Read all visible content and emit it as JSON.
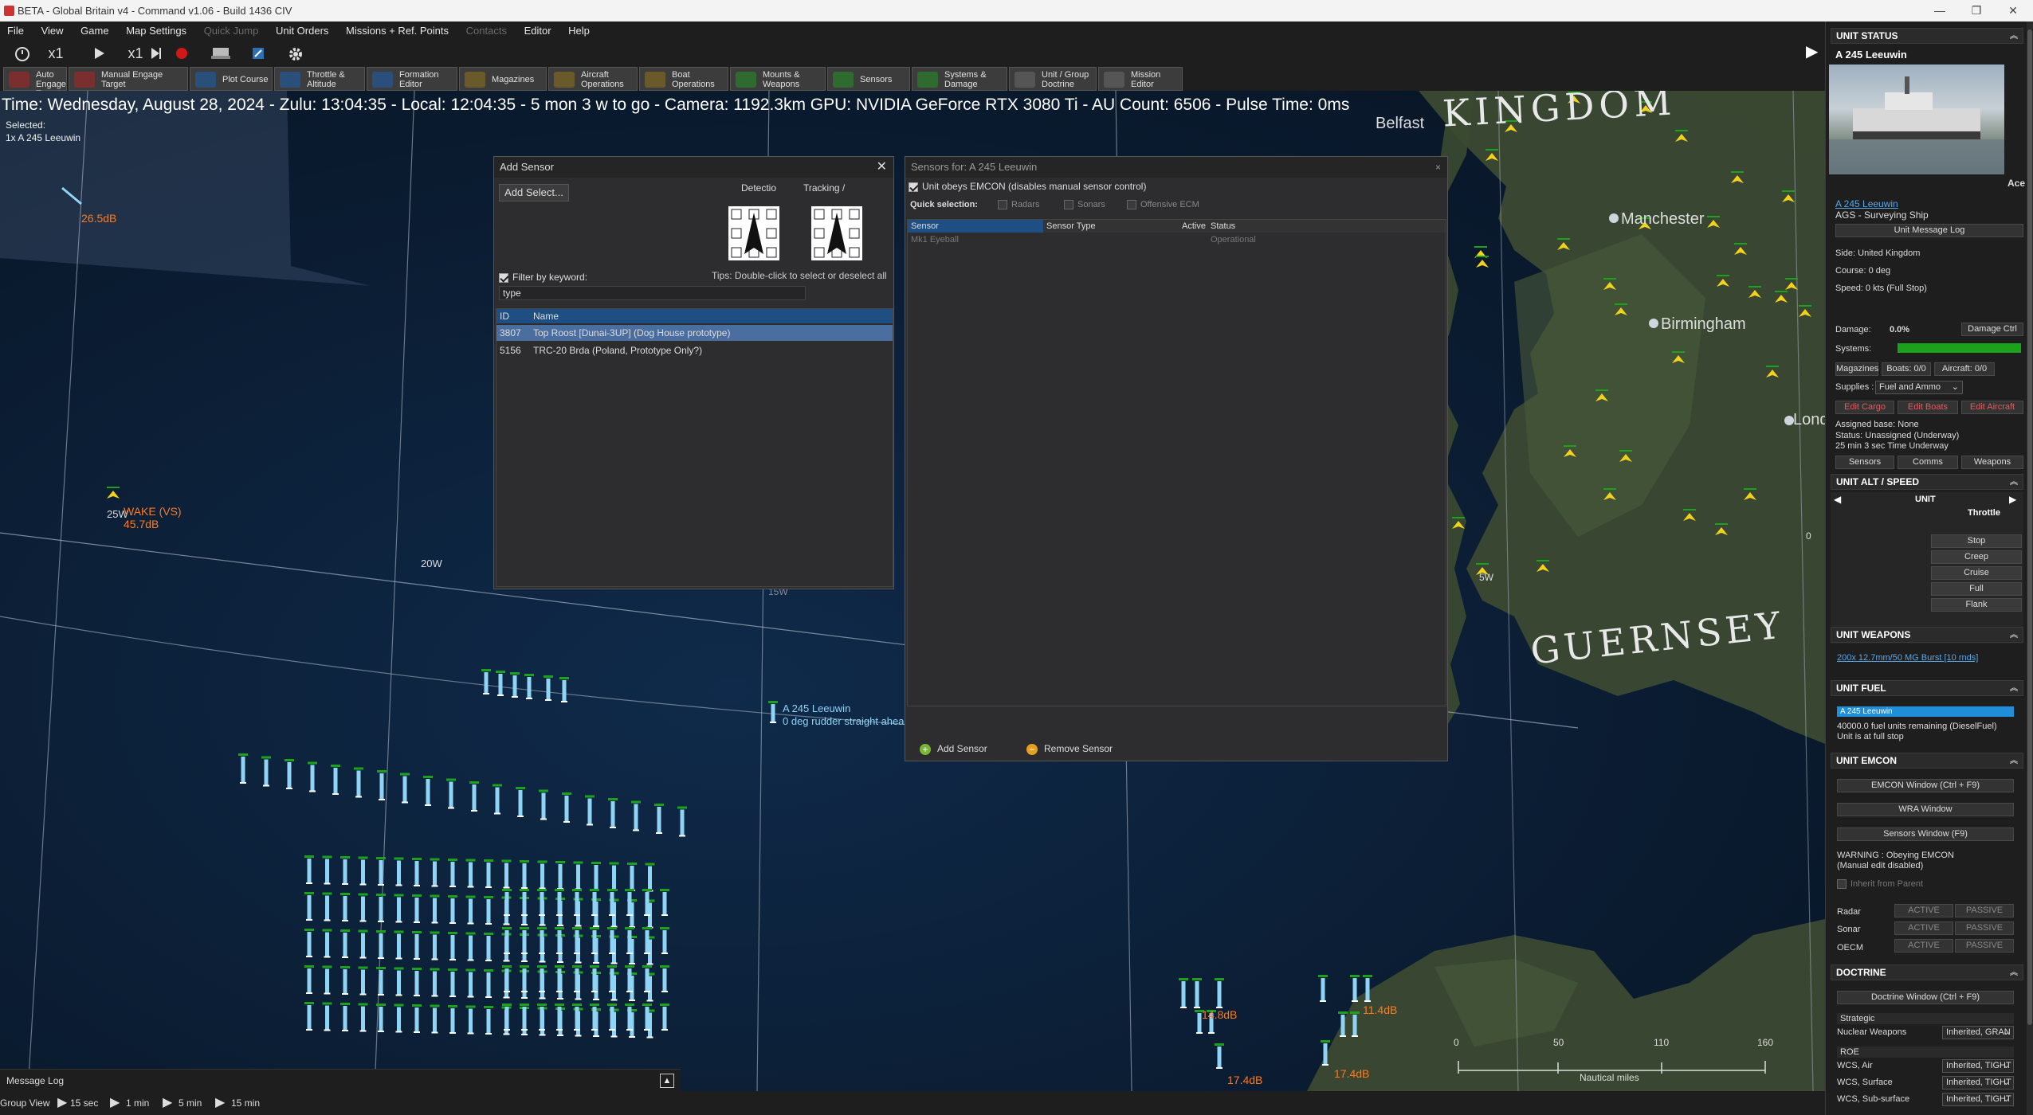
{
  "window": {
    "title": "BETA - Global Britain v4 - Command v1.06 - Build 1436 CIV",
    "minimize": "—",
    "maximize": "❐",
    "close": "✕"
  },
  "menu": [
    "File",
    "View",
    "Game",
    "Map Settings",
    "Quick Jump",
    "Unit Orders",
    "Missions + Ref. Points",
    "Contacts",
    "Editor",
    "Help"
  ],
  "toolbar1": {
    "speed1": "x1",
    "speed2": "x1"
  },
  "toolbar2": [
    {
      "label": "Auto Engage Target"
    },
    {
      "label": "Manual Engage Target"
    },
    {
      "label": "Plot Course"
    },
    {
      "label": "Throttle & Altitude"
    },
    {
      "label": "Formation Editor"
    },
    {
      "label": "Magazines"
    },
    {
      "label": "Aircraft Operations"
    },
    {
      "label": "Boat Operations"
    },
    {
      "label": "Mounts & Weapons"
    },
    {
      "label": "Sensors"
    },
    {
      "label": "Systems & Damage"
    },
    {
      "label": "Unit / Group Doctrine"
    },
    {
      "label": "Mission Editor"
    }
  ],
  "map": {
    "status_line": "Time: Wednesday, August 28, 2024 - Zulu: 13:04:35 - Local: 12:04:35 - 5 mon 3 w to go - Camera: 1192.3km GPU: NVIDIA GeForce RTX 3080 Ti - AU Count: 6506 - Pulse Time: 0ms",
    "selected_label": "Selected:",
    "selected_value": "1x A 245 Leeuwin",
    "labels": {
      "kingdom": "KINGDOM",
      "guernsey": "GUERNSEY",
      "belfast": "Belfast",
      "manchester": "Manchester",
      "birmingham": "Birmingham",
      "london": "Lond",
      "lon_20w": "20W",
      "lon_25w": "25W",
      "lon_15w": "15W",
      "lon_5w": "5W",
      "lon_0": "0",
      "wake": "WAKE (VS)",
      "wake_db": "45.7dB",
      "db_top": "26.5dB",
      "unit_name": "A 245 Leeuwin",
      "unit_course": "0 deg  rudder straight ahead",
      "db_a": "14.8dB",
      "db_b": "11.4dB",
      "db_c": "17.4dB",
      "db_d": "17.4dB"
    },
    "scale": {
      "ticks": [
        "0",
        "50",
        "110",
        "160"
      ],
      "unit": "Nautical miles"
    }
  },
  "add_sensor": {
    "title": "Add Sensor",
    "close": "✕",
    "add_select": "Add Select...",
    "detection": "Detectio",
    "tracking": "Tracking /",
    "tips": "Tips: Double-click to select or deselect all",
    "filter_label": "Filter by keyword:",
    "filter_value": "type",
    "columns": [
      "ID",
      "Name"
    ],
    "rows": [
      {
        "id": "3807",
        "name": "Top Roost [Dunai-3UP] (Dog House prototype)"
      },
      {
        "id": "5156",
        "name": "TRC-20 Brda (Poland, Prototype Only?)"
      }
    ]
  },
  "sensors_for": {
    "title": "Sensors for: A 245 Leeuwin",
    "close": "×",
    "emcon_label": "Unit obeys EMCON (disables manual sensor control)",
    "quick_label": "Quick selection:",
    "quick": [
      "Radars",
      "Sonars",
      "Offensive ECM"
    ],
    "columns": [
      "Sensor",
      "Sensor Type",
      "Active",
      "Status"
    ],
    "rows": [
      {
        "sensor": "Mk1 Eyeball",
        "type": "",
        "active": "",
        "status": "Operational"
      }
    ],
    "add_btn": "Add Sensor",
    "remove_btn": "Remove Sensor"
  },
  "unit_status": {
    "header": "UNIT STATUS",
    "name": "A 245 Leeuwin",
    "ace": "Ace",
    "link": "A 245 Leeuwin",
    "type": "AGS - Surveying Ship",
    "msg_log": "Unit Message Log",
    "side": "Side: United Kingdom",
    "course": "Course: 0 deg",
    "speed": "Speed: 0 kts (Full Stop)",
    "damage_label": "Damage:",
    "damage_value": "0.0%",
    "damage_btn": "Damage Ctrl",
    "systems_label": "Systems:",
    "systems_level": 1.0,
    "magazines": "Magazines",
    "boats": "Boats: 0/0",
    "aircraft": "Aircraft: 0/0",
    "supplies_label": "Supplies :",
    "supplies_value": "Fuel and Ammo",
    "edit_cargo": "Edit Cargo",
    "edit_boats": "Edit Boats",
    "edit_aircraft": "Edit Aircraft",
    "assigned": "Assigned base: None",
    "status": "Status: Unassigned (Underway)",
    "underway": "25 min 3 sec Time Underway",
    "btn_sensors": "Sensors",
    "btn_comms": "Comms",
    "btn_weapons": "Weapons"
  },
  "alt_speed": {
    "header": "UNIT ALT / SPEED",
    "unit": "UNIT",
    "throttle": "Throttle",
    "buttons": [
      "Stop",
      "Creep",
      "Cruise",
      "Full",
      "Flank"
    ]
  },
  "weapons": {
    "header": "UNIT WEAPONS",
    "item": "200x 12.7mm/50 MG Burst [10 rnds]"
  },
  "fuel": {
    "header": "UNIT FUEL",
    "bar_label": "A 245 Leeuwin",
    "level": 1.0,
    "remaining": "40000.0 fuel units remaining (DieselFuel)",
    "state": "Unit is at full stop"
  },
  "emcon": {
    "header": "UNIT EMCON",
    "emcon_window": "EMCON Window (Ctrl + F9)",
    "wra_window": "WRA Window",
    "sensors_window": "Sensors Window (F9)",
    "warning": "WARNING : Obeying EMCON",
    "warning2": "(Manual edit disabled)",
    "inherit": "Inherit from Parent",
    "rows": [
      "Radar",
      "Sonar",
      "OECM"
    ],
    "active": "ACTIVE",
    "passive": "PASSIVE"
  },
  "doctrine": {
    "header": "DOCTRINE",
    "window": "Doctrine Window (Ctrl + F9)",
    "strategic": "Strategic",
    "nuclear_label": "Nuclear Weapons",
    "nuclear_value": "Inherited, GRAN",
    "roe": "ROE",
    "wcs": [
      {
        "label": "WCS, Air",
        "value": "Inherited, TIGHT"
      },
      {
        "label": "WCS, Surface",
        "value": "Inherited, TIGHT"
      },
      {
        "label": "WCS, Sub-surface",
        "value": "Inherited, TIGHT"
      }
    ]
  },
  "message_log": "Message Log",
  "bottom": {
    "group_view": "Group View",
    "steps": [
      "15 sec",
      "1 min",
      "5 min",
      "15 min"
    ]
  },
  "colors": {
    "accent": "#1e6fb5",
    "green": "#1aa31a",
    "orange": "#ff7a1a",
    "cyan": "#8fd3f5"
  }
}
